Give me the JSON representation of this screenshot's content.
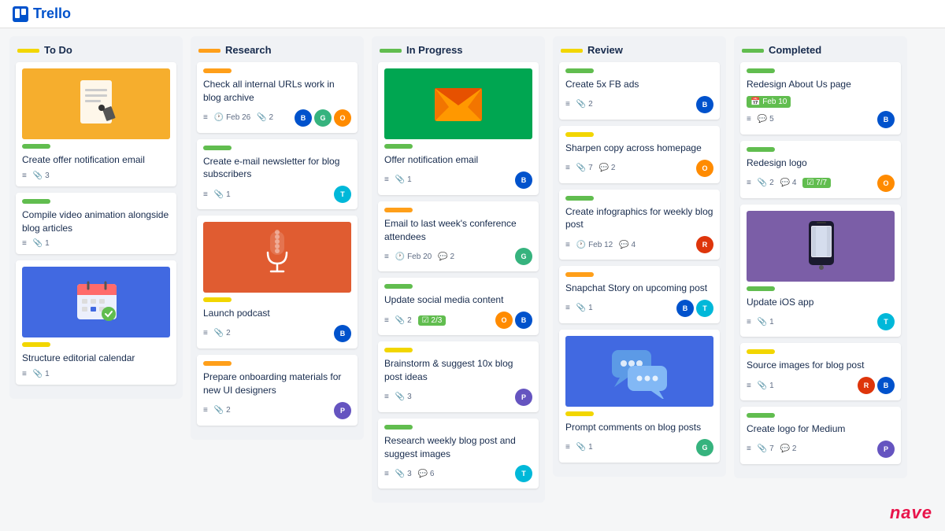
{
  "app": {
    "name": "Trello",
    "logo_text": "Trello"
  },
  "columns": [
    {
      "id": "todo",
      "title": "To Do",
      "label_color": "yellow",
      "cards": [
        {
          "id": "todo-1",
          "has_image": true,
          "image_type": "yellow-document",
          "label": "green",
          "title": "Create offer notification email",
          "meta": {
            "lines": true,
            "clips": 3,
            "avatars": []
          }
        },
        {
          "id": "todo-2",
          "has_image": false,
          "label": "green",
          "title": "Compile video animation alongside blog articles",
          "meta": {
            "lines": true,
            "clips": 1,
            "avatars": []
          }
        },
        {
          "id": "todo-3",
          "has_image": true,
          "image_type": "blue-calendar",
          "label": "yellow",
          "title": "Structure editorial calendar",
          "meta": {
            "lines": true,
            "clips": 1,
            "avatars": []
          }
        }
      ]
    },
    {
      "id": "research",
      "title": "Research",
      "label_color": "orange",
      "cards": [
        {
          "id": "res-1",
          "has_image": false,
          "label": "orange",
          "title": "Check all internal URLs work in blog archive",
          "date": "Feb 26",
          "meta": {
            "lines": true,
            "clips": 2,
            "avatars": [
              "blue",
              "green",
              "orange"
            ]
          }
        },
        {
          "id": "res-2",
          "has_image": false,
          "label": "green",
          "title": "Create e-mail newsletter for blog subscribers",
          "meta": {
            "lines": true,
            "clips": 1,
            "avatars": [
              "teal"
            ]
          }
        },
        {
          "id": "res-3",
          "has_image": true,
          "image_type": "orange-microphone",
          "label": "yellow",
          "title": "Launch podcast",
          "meta": {
            "lines": true,
            "clips": 2,
            "avatars": [
              "blue"
            ]
          }
        },
        {
          "id": "res-4",
          "has_image": false,
          "label": "orange",
          "title": "Prepare onboarding materials for new UI designers",
          "meta": {
            "lines": true,
            "clips": 2,
            "avatars": [
              "purple"
            ]
          }
        }
      ]
    },
    {
      "id": "inprogress",
      "title": "In Progress",
      "label_color": "green",
      "cards": [
        {
          "id": "ip-1",
          "has_image": true,
          "image_type": "green-email",
          "label": "green",
          "title": "Offer notification email",
          "meta": {
            "lines": true,
            "clips": 1,
            "avatars": [
              "blue"
            ]
          }
        },
        {
          "id": "ip-2",
          "has_image": false,
          "label": "orange",
          "title": "Email to last week's conference attendees",
          "date": "Feb 20",
          "meta": {
            "lines": true,
            "comments": 2,
            "avatars": [
              "green"
            ]
          }
        },
        {
          "id": "ip-3",
          "has_image": false,
          "label": "green",
          "title": "Update social media content",
          "meta": {
            "lines": true,
            "clips": 2,
            "progress": "2/3",
            "avatars": [
              "orange",
              "blue"
            ]
          }
        },
        {
          "id": "ip-4",
          "has_image": false,
          "label": "yellow",
          "title": "Brainstorm & suggest 10x blog post ideas",
          "meta": {
            "lines": true,
            "clips": 3,
            "avatars": [
              "purple"
            ]
          }
        },
        {
          "id": "ip-5",
          "has_image": false,
          "label": "green",
          "title": "Research weekly blog post and suggest images",
          "meta": {
            "lines": true,
            "clips": 3,
            "comments": 6,
            "avatars": [
              "teal"
            ]
          }
        }
      ]
    },
    {
      "id": "review",
      "title": "Review",
      "label_color": "yellow",
      "cards": [
        {
          "id": "rev-1",
          "has_image": false,
          "label": "green",
          "title": "Create 5x FB ads",
          "meta": {
            "lines": true,
            "clips": 2,
            "avatars": [
              "blue"
            ]
          }
        },
        {
          "id": "rev-2",
          "has_image": false,
          "label": "yellow",
          "title": "Sharpen copy across homepage",
          "meta": {
            "lines": true,
            "clips": 7,
            "comments": 2,
            "avatars": [
              "orange"
            ]
          }
        },
        {
          "id": "rev-3",
          "has_image": false,
          "label": "green",
          "title": "Create infographics for weekly blog post",
          "date": "Feb 12",
          "meta": {
            "lines": true,
            "comments": 4,
            "avatars": [
              "red"
            ]
          }
        },
        {
          "id": "rev-4",
          "has_image": false,
          "label": "orange",
          "title": "Snapchat Story on upcoming post",
          "meta": {
            "lines": true,
            "clips": 1,
            "avatars": [
              "blue",
              "teal"
            ]
          }
        },
        {
          "id": "rev-5",
          "has_image": true,
          "image_type": "blue-chat",
          "label": "yellow",
          "title": "Prompt comments on blog posts",
          "meta": {
            "lines": true,
            "clips": 1,
            "avatars": [
              "green"
            ]
          }
        }
      ]
    },
    {
      "id": "completed",
      "title": "Completed",
      "label_color": "green",
      "cards": [
        {
          "id": "comp-1",
          "has_image": false,
          "label": "green",
          "title": "Redesign About Us page",
          "date_badge": "Feb 10",
          "date_badge_color": "green",
          "meta": {
            "lines": true,
            "comments": 5,
            "avatars": [
              "blue"
            ]
          }
        },
        {
          "id": "comp-2",
          "has_image": false,
          "label": "green",
          "title": "Redesign logo",
          "meta": {
            "lines": true,
            "comments": 4,
            "clips": 2,
            "progress": "7/7",
            "avatars": [
              "orange"
            ]
          }
        },
        {
          "id": "comp-3",
          "has_image": true,
          "image_type": "purple-phone",
          "label": "green",
          "title": "Update iOS app",
          "meta": {
            "lines": true,
            "clips": 1,
            "avatars": [
              "teal"
            ]
          }
        },
        {
          "id": "comp-4",
          "has_image": false,
          "label": "yellow",
          "title": "Source images for blog post",
          "meta": {
            "lines": true,
            "clips": 1,
            "avatars": [
              "red",
              "blue"
            ]
          }
        },
        {
          "id": "comp-5",
          "has_image": false,
          "label": "green",
          "title": "Create logo for Medium",
          "meta": {
            "lines": true,
            "clips": 7,
            "comments": 2,
            "avatars": [
              "purple"
            ]
          }
        }
      ]
    }
  ],
  "nave": "nave"
}
